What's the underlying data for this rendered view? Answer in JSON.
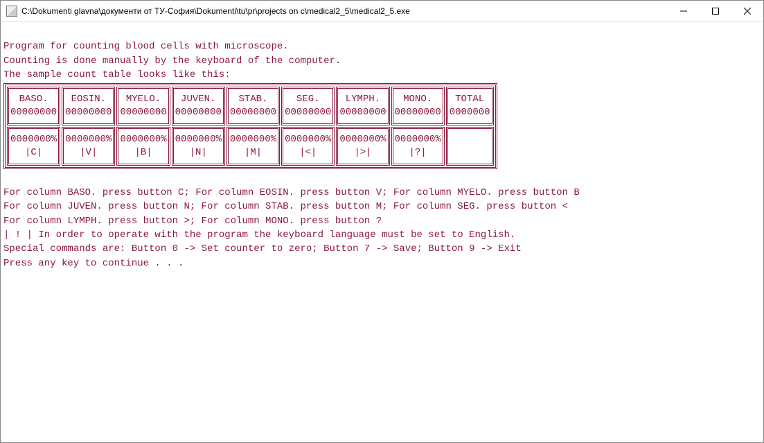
{
  "window": {
    "title": "C:\\Dokumenti glavna\\документи от ТУ-София\\Dokumenti\\tu\\pr\\projects on c\\medical2_5\\medical2_5.exe"
  },
  "intro": {
    "line1": "Program for counting blood cells with microscope.",
    "line2": "Counting is done manually by the keyboard of the computer.",
    "line3": "The sample count table looks like this:"
  },
  "table": {
    "cols": [
      {
        "head": "BASO.",
        "count": "00000000",
        "pct": "0000000%",
        "key": "|C|"
      },
      {
        "head": "EOSIN.",
        "count": "00000000",
        "pct": "0000000%",
        "key": "|V|"
      },
      {
        "head": "MYELO.",
        "count": "00000000",
        "pct": "0000000%",
        "key": "|B|"
      },
      {
        "head": "JUVEN.",
        "count": "00000000",
        "pct": "0000000%",
        "key": "|N|"
      },
      {
        "head": "STAB.",
        "count": "00000000",
        "pct": "0000000%",
        "key": "|M|"
      },
      {
        "head": "SEG.",
        "count": "00000000",
        "pct": "0000000%",
        "key": "|<|"
      },
      {
        "head": "LYMPH.",
        "count": "00000000",
        "pct": "0000000%",
        "key": "|>|"
      },
      {
        "head": "MONO.",
        "count": "00000000",
        "pct": "0000000%",
        "key": "|?|"
      }
    ],
    "total": {
      "head": "TOTAL",
      "count": "0000000"
    }
  },
  "after": {
    "l1": "For column BASO. press button C; For column EOSIN. press button V; For column MYELO. press button B",
    "l2": "For column JUVEN. press button N; For column STAB. press button M; For column SEG. press button <",
    "l3": "For column LYMPH. press button >; For column MONO. press button ?",
    "l4": "| ! | In order to operate with the program the keyboard language must be set to English.",
    "l5": "Special commands are: Button 0 -> Set counter to zero; Button 7 -> Save; Button 9 -> Exit",
    "l6": "Press any key to continue . . ."
  }
}
